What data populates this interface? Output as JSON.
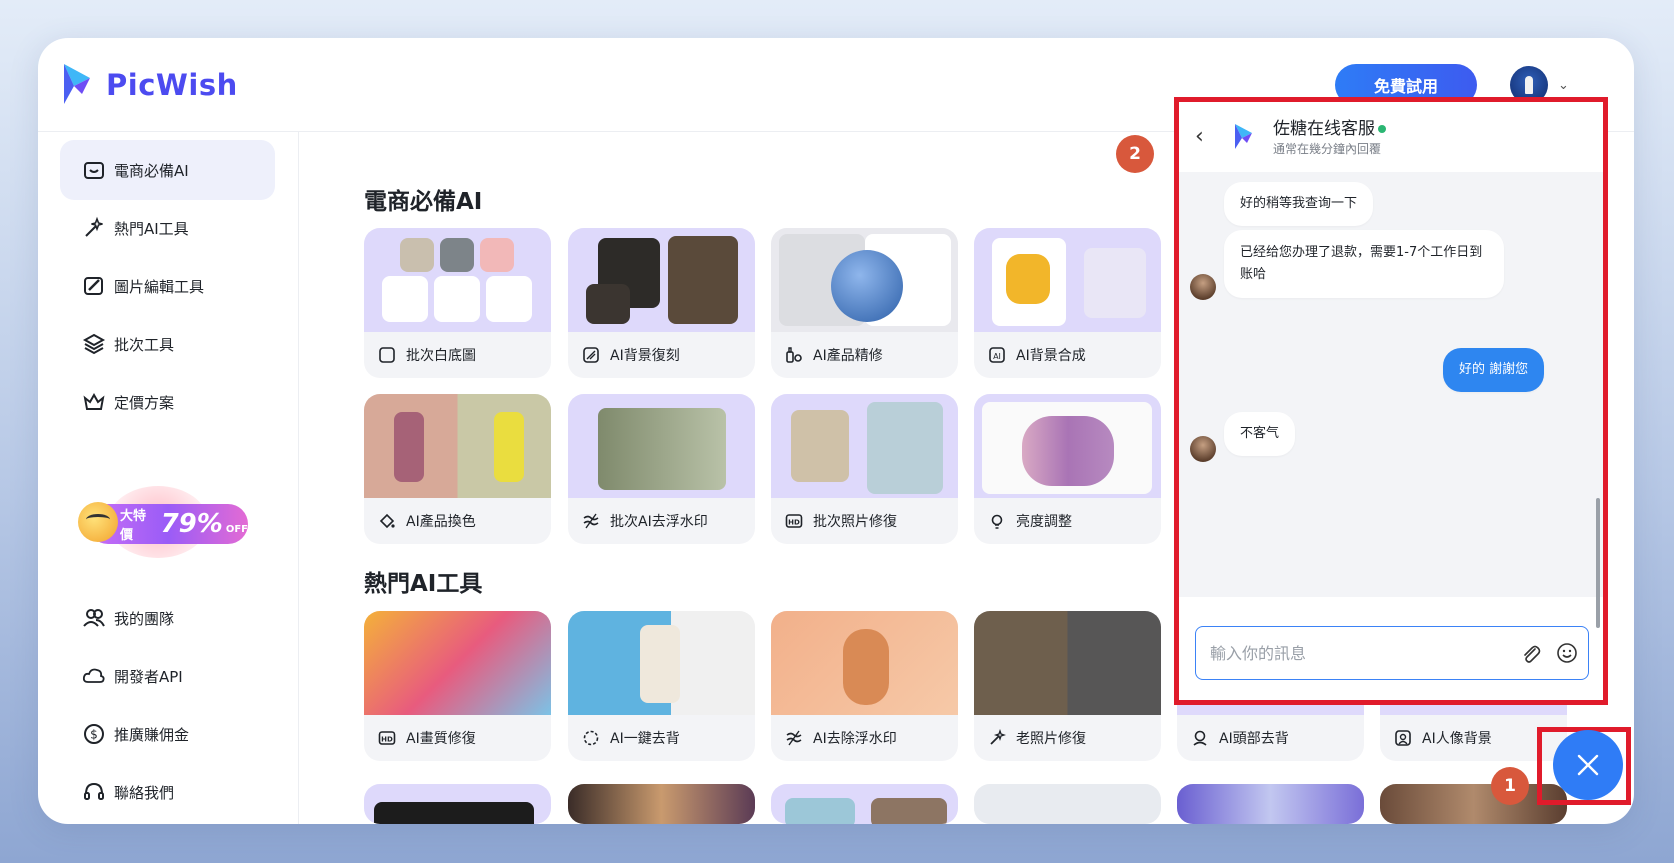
{
  "brand": {
    "name": "PicWish"
  },
  "header": {
    "trial_button": "免費試用"
  },
  "sidebar": {
    "items": [
      {
        "label": "電商必備AI"
      },
      {
        "label": "熱門AI工具"
      },
      {
        "label": "圖片編輯工具"
      },
      {
        "label": "批次工具"
      },
      {
        "label": "定價方案"
      },
      {
        "label": "我的團隊"
      },
      {
        "label": "開發者API"
      },
      {
        "label": "推廣賺佣金"
      },
      {
        "label": "聯絡我們"
      }
    ],
    "promo": {
      "small": "大特價",
      "big": "79%",
      "off": "OFF"
    }
  },
  "sections": [
    {
      "title": "電商必備AI",
      "cards": [
        {
          "label": "批次白底圖",
          "icon": "square-icon"
        },
        {
          "label": "AI背景復刻",
          "icon": "layers-icon"
        },
        {
          "label": "AI產品精修",
          "icon": "product-icon"
        },
        {
          "label": "AI背景合成",
          "icon": "ai-bg-icon"
        },
        {
          "label": "AI產品換色",
          "icon": "paint-bucket-icon"
        },
        {
          "label": "批次AI去浮水印",
          "icon": "watermark-icon"
        },
        {
          "label": "批次照片修復",
          "icon": "hd-icon"
        },
        {
          "label": "亮度調整",
          "icon": "bulb-icon"
        }
      ]
    },
    {
      "title": "熱門AI工具",
      "cards": [
        {
          "label": "AI畫質修復",
          "icon": "hd-icon"
        },
        {
          "label": "AI一鍵去背",
          "icon": "cutout-icon"
        },
        {
          "label": "AI去除浮水印",
          "icon": "watermark-icon"
        },
        {
          "label": "老照片修復",
          "icon": "magic-wand-icon"
        },
        {
          "label": "AI頭部去背",
          "icon": "head-icon"
        },
        {
          "label": "AI人像背景",
          "icon": "portrait-bg-icon"
        }
      ]
    }
  ],
  "badges": {
    "one": "1",
    "two": "2"
  },
  "chat": {
    "agent_name": "佐糖在线客服",
    "subtitle": "通常在幾分鐘內回覆",
    "messages": [
      {
        "from": "agent",
        "text": "好的稍等我查询一下"
      },
      {
        "from": "agent",
        "text": "已经给您办理了退款，需要1-7个工作日到账哈"
      },
      {
        "from": "user",
        "text": "好的 謝謝您"
      },
      {
        "from": "agent",
        "text": "不客气"
      }
    ],
    "input_placeholder": "輸入你的訊息"
  },
  "colors": {
    "brand": "#4c4bf0",
    "accent": "#2f7cf6",
    "highlight": "#e01b2b",
    "badge": "#d8583c"
  }
}
